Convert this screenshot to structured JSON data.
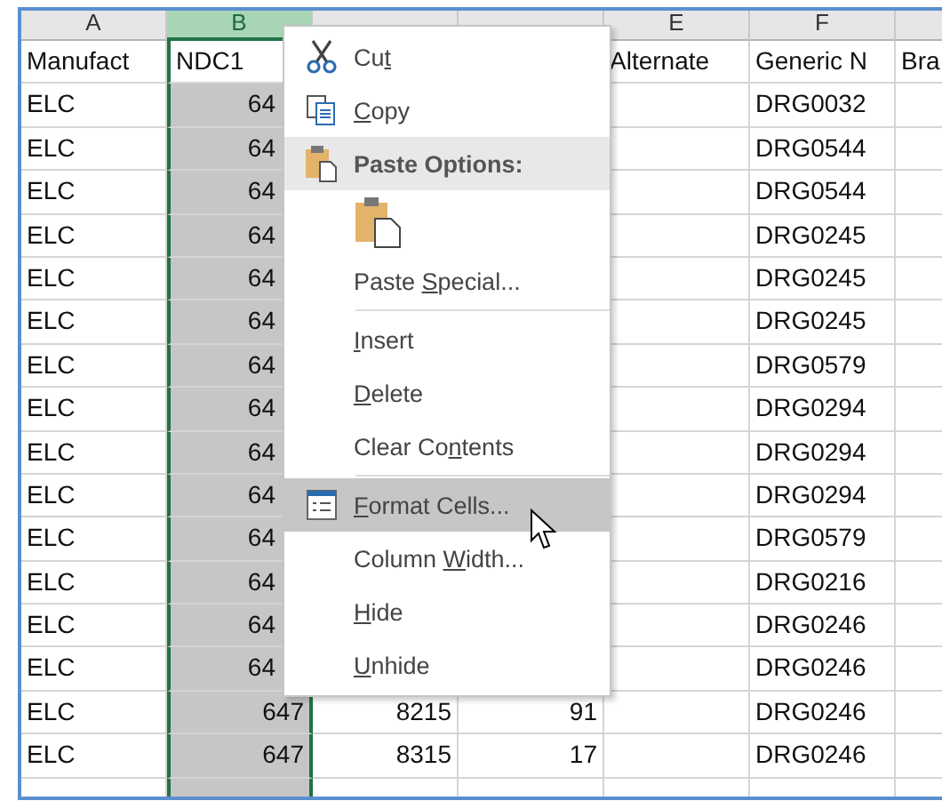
{
  "sheet": {
    "columns": [
      {
        "letter": "A",
        "selected": false
      },
      {
        "letter": "B",
        "selected": true
      },
      {
        "selected": false
      },
      {
        "selected": false
      },
      {
        "letter": "E",
        "selected": false
      },
      {
        "letter": "F",
        "selected": false
      }
    ],
    "rows": [
      {
        "cells": [
          "Manufact",
          "NDC1",
          null,
          null,
          "Alternate",
          "Generic N",
          "Bra"
        ]
      },
      {
        "cells": [
          "ELC",
          "64",
          null,
          null,
          null,
          "DRG0032",
          null
        ]
      },
      {
        "cells": [
          "ELC",
          "64",
          null,
          null,
          null,
          "DRG0544",
          null
        ]
      },
      {
        "cells": [
          "ELC",
          "64",
          null,
          null,
          null,
          "DRG0544",
          null
        ]
      },
      {
        "cells": [
          "ELC",
          "64",
          null,
          null,
          null,
          "DRG0245",
          null
        ]
      },
      {
        "cells": [
          "ELC",
          "64",
          null,
          null,
          null,
          "DRG0245",
          null
        ]
      },
      {
        "cells": [
          "ELC",
          "64",
          null,
          null,
          null,
          "DRG0245",
          null
        ]
      },
      {
        "cells": [
          "ELC",
          "64",
          null,
          null,
          null,
          "DRG0579",
          null
        ]
      },
      {
        "cells": [
          "ELC",
          "64",
          null,
          null,
          null,
          "DRG0294",
          null
        ]
      },
      {
        "cells": [
          "ELC",
          "64",
          null,
          null,
          null,
          "DRG0294",
          null
        ]
      },
      {
        "cells": [
          "ELC",
          "64",
          null,
          null,
          null,
          "DRG0294",
          null
        ]
      },
      {
        "cells": [
          "ELC",
          "64",
          null,
          null,
          null,
          "DRG0579",
          null
        ]
      },
      {
        "cells": [
          "ELC",
          "64",
          null,
          null,
          null,
          "DRG0216",
          null
        ]
      },
      {
        "cells": [
          "ELC",
          "64",
          null,
          null,
          null,
          "DRG0246",
          null
        ]
      },
      {
        "cells": [
          "ELC",
          "64",
          null,
          null,
          null,
          "DRG0246",
          null
        ]
      },
      {
        "cells": [
          "ELC",
          "647",
          "8215",
          "91",
          null,
          "DRG0246",
          null
        ]
      },
      {
        "cells": [
          "ELC",
          "647",
          "8315",
          "17",
          null,
          "DRG0246",
          null
        ]
      }
    ]
  },
  "context_menu": {
    "items": [
      {
        "kind": "item",
        "selected": false,
        "segments": [
          {
            "text": "Cu",
            "underline": false
          },
          {
            "text": "t",
            "underline": true
          }
        ]
      },
      {
        "kind": "item",
        "selected": false,
        "segments": [
          {
            "text": "C",
            "underline": true
          },
          {
            "text": "opy",
            "underline": false
          }
        ]
      },
      {
        "kind": "header",
        "segments": [
          {
            "text": "Paste Options:",
            "underline": false
          }
        ]
      },
      {
        "kind": "paste-icons"
      },
      {
        "kind": "item",
        "selected": false,
        "segments": [
          {
            "text": "Paste ",
            "underline": false
          },
          {
            "text": "S",
            "underline": true
          },
          {
            "text": "pecial...",
            "underline": false
          }
        ]
      },
      {
        "kind": "separator"
      },
      {
        "kind": "item",
        "selected": false,
        "segments": [
          {
            "text": "I",
            "underline": true
          },
          {
            "text": "nsert",
            "underline": false
          }
        ]
      },
      {
        "kind": "item",
        "selected": false,
        "segments": [
          {
            "text": "D",
            "underline": true
          },
          {
            "text": "elete",
            "underline": false
          }
        ]
      },
      {
        "kind": "item",
        "selected": false,
        "segments": [
          {
            "text": "Clear Co",
            "underline": false
          },
          {
            "text": "n",
            "underline": true
          },
          {
            "text": "tents",
            "underline": false
          }
        ]
      },
      {
        "kind": "separator"
      },
      {
        "kind": "item",
        "selected": true,
        "segments": [
          {
            "text": "F",
            "underline": true
          },
          {
            "text": "ormat Cells...",
            "underline": false
          }
        ]
      },
      {
        "kind": "item",
        "selected": false,
        "segments": [
          {
            "text": "Column ",
            "underline": false
          },
          {
            "text": "W",
            "underline": true
          },
          {
            "text": "idth...",
            "underline": false
          }
        ]
      },
      {
        "kind": "item",
        "selected": false,
        "segments": [
          {
            "text": "H",
            "underline": true
          },
          {
            "text": "ide",
            "underline": false
          }
        ]
      },
      {
        "kind": "item",
        "selected": false,
        "segments": [
          {
            "text": "U",
            "underline": true
          },
          {
            "text": "nhide",
            "underline": false
          }
        ]
      }
    ]
  }
}
